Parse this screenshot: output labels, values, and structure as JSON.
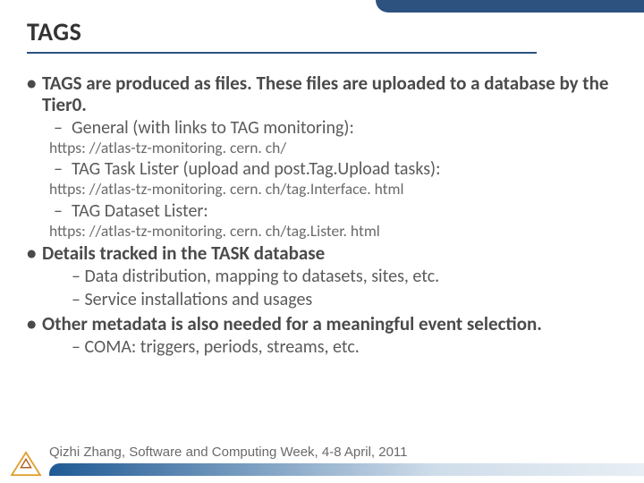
{
  "title": "TAGS",
  "bullets": {
    "b1_1": "TAGS are produced as files. These files are uploaded to a database by the Tier0.",
    "b2_1": "General (with links to TAG monitoring):",
    "link_1": "https: //atlas-tz-monitoring. cern. ch/",
    "b2_2": "TAG Task Lister (upload and post.Tag.Upload tasks):",
    "link_2": "https: //atlas-tz-monitoring. cern. ch/tag.Interface. html",
    "b2_3": "TAG Dataset Lister:",
    "link_3": "https: //atlas-tz-monitoring. cern. ch/tag.Lister. html",
    "b1_2": "Details tracked in the TASK database",
    "b2_4": "Data distribution, mapping to datasets, sites, etc.",
    "b2_5": "Service installations and usages",
    "b1_3": "Other metadata is also needed for a meaningful event selection.",
    "b2_6": "COMA: triggers, periods, streams, etc."
  },
  "footer": "Qizhi Zhang, Software and Computing Week, 4-8 April, 2011"
}
